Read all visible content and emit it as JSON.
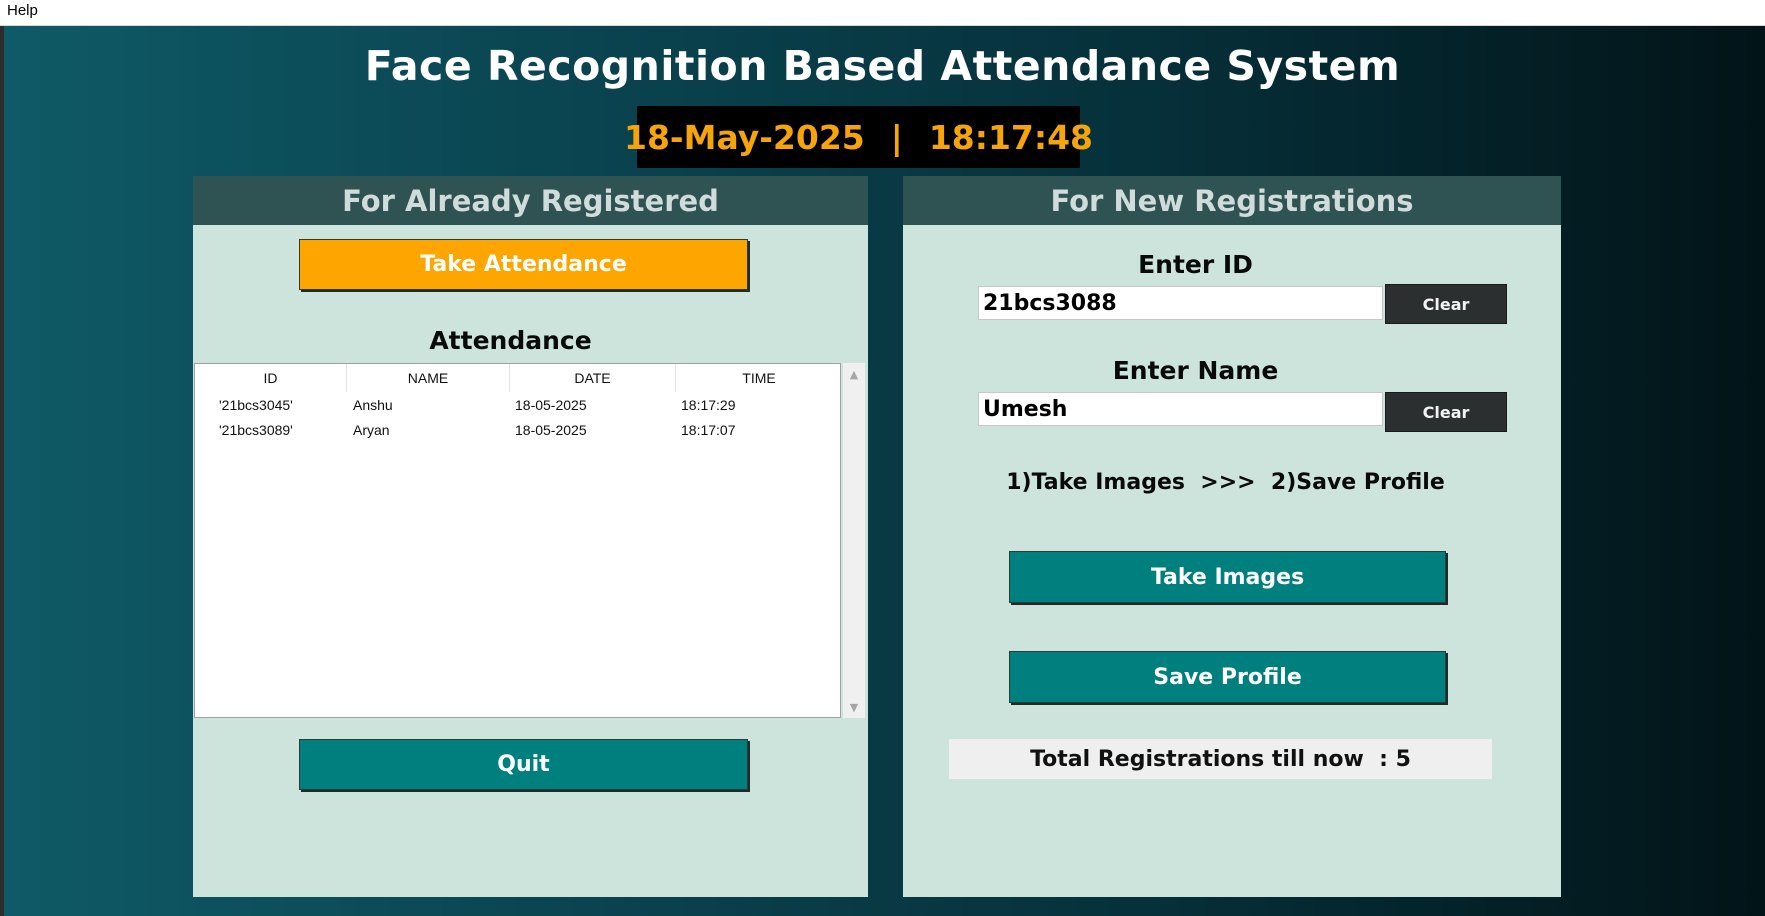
{
  "menubar": {
    "help_label": "Help"
  },
  "header": {
    "title": "Face Recognition Based Attendance System",
    "date": "18-May-2025",
    "separator": "|",
    "time": "18:17:48"
  },
  "left_panel": {
    "title": "For Already Registered",
    "take_attendance_label": "Take Attendance",
    "attendance_heading": "Attendance",
    "table": {
      "columns": [
        "ID",
        "NAME",
        "DATE",
        "TIME"
      ],
      "rows": [
        [
          "'21bcs3045'",
          "Anshu",
          "18-05-2025",
          "18:17:29"
        ],
        [
          "'21bcs3089'",
          "Aryan",
          "18-05-2025",
          "18:17:07"
        ]
      ]
    },
    "quit_label": "Quit"
  },
  "right_panel": {
    "title": "For New Registrations",
    "enter_id_label": "Enter ID",
    "id_value": "21bcs3088",
    "clear_label": "Clear",
    "enter_name_label": "Enter Name",
    "name_value": "Umesh",
    "steps_text": "1)Take Images  >>>  2)Save Profile",
    "take_images_label": "Take Images",
    "save_profile_label": "Save Profile",
    "total_text": "Total Registrations till now  : 5"
  },
  "colors": {
    "accent_orange": "#fea500",
    "teal_button": "#007f7f",
    "panel_bg": "#cde4dd",
    "panel_header": "#2f5352",
    "clock_text": "#f5a50b"
  }
}
